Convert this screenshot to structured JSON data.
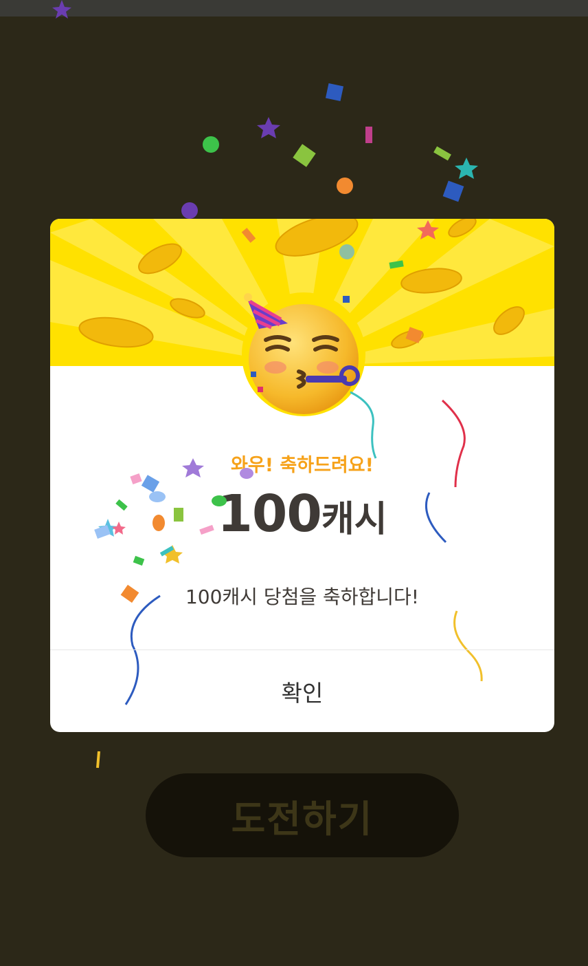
{
  "dialog": {
    "subtitle": "와우! 축하드려요!",
    "reward_amount": "100",
    "reward_unit": "캐시",
    "message": "100캐시 당첨을 축하합니다!",
    "confirm_label": "확인",
    "emoji": "partying-face-icon"
  },
  "background": {
    "challenge_label": "도전하기"
  },
  "colors": {
    "banner": "#ffe100",
    "accent": "#f6a21a",
    "backdrop": "#2c2818",
    "text": "#3f3a36"
  }
}
